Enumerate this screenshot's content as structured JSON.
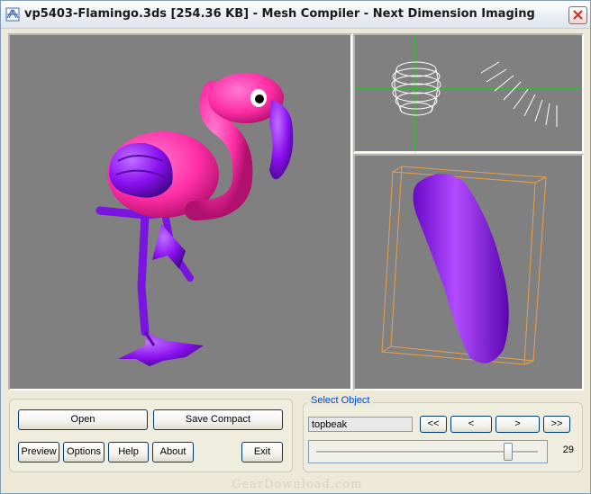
{
  "window": {
    "title": "vp5403-Flamingo.3ds [254.36 KB] - Mesh Compiler - Next Dimension Imaging",
    "close_icon": "close-icon",
    "app_icon": "app-icon"
  },
  "colors": {
    "viewport_bg": "#808080",
    "body_pink": "#ff2fa6",
    "mesh_purple": "#8a10f0",
    "grid_green": "#22c422",
    "bbox_orange": "#e8a04a",
    "group_label": "#0046d5"
  },
  "buttons": {
    "open": "Open",
    "save_compact": "Save Compact",
    "preview": "Preview",
    "options": "Options",
    "help": "Help",
    "about": "About",
    "exit": "Exit"
  },
  "select_object": {
    "label": "Select Object",
    "value": "topbeak",
    "first": "<<",
    "prev": "<",
    "next": ">",
    "last": ">>",
    "slider_value": "29"
  },
  "watermark": "GearDownload.com"
}
